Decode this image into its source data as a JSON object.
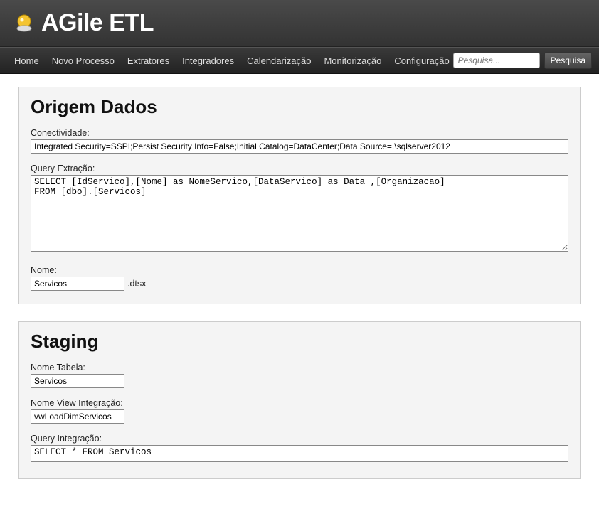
{
  "app": {
    "title": "AGile ETL"
  },
  "nav": {
    "items": [
      {
        "label": "Home"
      },
      {
        "label": "Novo Processo"
      },
      {
        "label": "Extratores"
      },
      {
        "label": "Integradores"
      },
      {
        "label": "Calendarização"
      },
      {
        "label": "Monitorização"
      },
      {
        "label": "Configuração"
      }
    ],
    "search_placeholder": "Pesquisa...",
    "search_button": "Pesquisa"
  },
  "origem": {
    "title": "Origem Dados",
    "conectividade_label": "Conectividade:",
    "conectividade_value": "Integrated Security=SSPI;Persist Security Info=False;Initial Catalog=DataCenter;Data Source=.\\sqlserver2012",
    "query_label": "Query Extração:",
    "query_value": "SELECT [IdServico],[Nome] as NomeServico,[DataServico] as Data ,[Organizacao]\nFROM [dbo].[Servicos]",
    "nome_label": "Nome:",
    "nome_value": "Servicos",
    "nome_suffix": ".dtsx"
  },
  "staging": {
    "title": "Staging",
    "nome_tabela_label": "Nome Tabela:",
    "nome_tabela_value": "Servicos",
    "nome_view_label": "Nome View Integração:",
    "nome_view_value": "vwLoadDimServicos",
    "query_label": "Query Integração:",
    "query_value": "SELECT * FROM Servicos"
  }
}
